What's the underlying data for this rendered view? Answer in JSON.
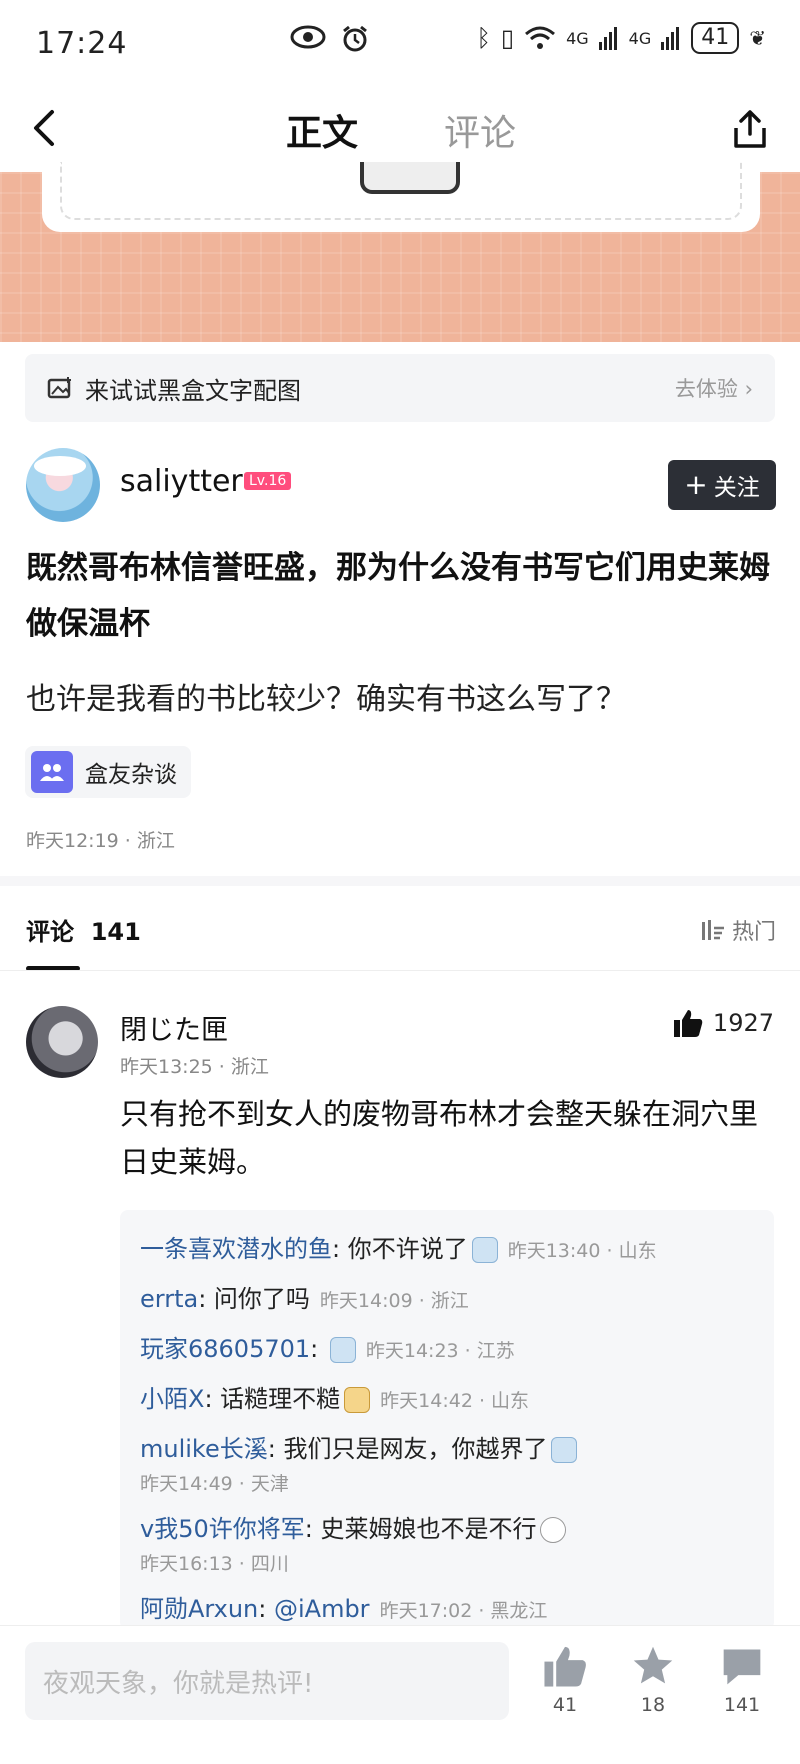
{
  "status": {
    "time": "17:24",
    "battery": "41",
    "net1": "4G",
    "net2": "4G"
  },
  "nav": {
    "tab_main": "正文",
    "tab_comments": "评论"
  },
  "promo": {
    "text": "来试试黑盒文字配图",
    "action": "去体验"
  },
  "author": {
    "name": "saliytter",
    "level": "Lv.16",
    "follow_label": "关注"
  },
  "post": {
    "title": "既然哥布林信誉旺盛，那为什么没有书写它们用史莱姆做保温杯",
    "body": "也许是我看的书比较少？确实有书这么写了？",
    "topic": "盒友杂谈",
    "meta": "昨天12:19 · 浙江"
  },
  "comments_header": {
    "label": "评论",
    "count": "141",
    "sort": "热门"
  },
  "comment": {
    "name": "閉じた匣",
    "time": "昨天13:25 · 浙江",
    "likes": "1927",
    "text": "只有抢不到女人的废物哥布林才会整天躲在洞穴里日史莱姆。",
    "replies": [
      {
        "name": "一条喜欢潜水的鱼",
        "text": "你不许说了",
        "time": "昨天13:40 · 山东"
      },
      {
        "name": "errta",
        "text": "问你了吗",
        "time": "昨天14:09 · 浙江"
      },
      {
        "name": "玩家68605701",
        "text": "",
        "time": "昨天14:23 · 江苏"
      },
      {
        "name": "小陌X",
        "text": "话糙理不糙",
        "time": "昨天14:42 · 山东"
      },
      {
        "name": "mulike长溪",
        "text": "我们只是网友，你越界了",
        "time": "昨天14:49 · 天津"
      },
      {
        "name": "v我50许你将军",
        "text": "史莱姆娘也不是不行",
        "time": "昨天16:13 · 四川"
      },
      {
        "name": "阿勋Arxun",
        "text": "@iAmbr",
        "time": "昨天17:02 · 黑龙江"
      }
    ]
  },
  "bottom": {
    "placeholder": "夜观天象，你就是热评!",
    "likes": "41",
    "stars": "18",
    "comments": "141"
  }
}
